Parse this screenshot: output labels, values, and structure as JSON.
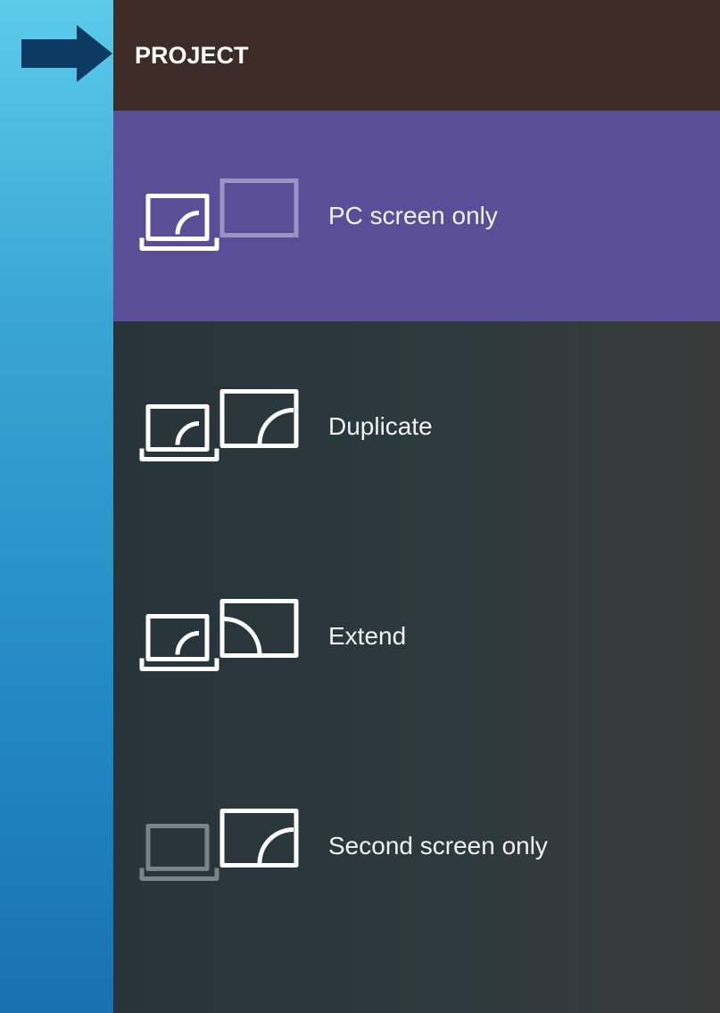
{
  "window": {
    "title": "PROJECT"
  },
  "options": [
    {
      "id": "pc-screen-only",
      "label": "PC screen only",
      "selected": true,
      "icon": "pc-screen-only-icon"
    },
    {
      "id": "duplicate",
      "label": "Duplicate",
      "selected": false,
      "icon": "duplicate-icon"
    },
    {
      "id": "extend",
      "label": "Extend",
      "selected": false,
      "icon": "extend-icon"
    },
    {
      "id": "second-screen-only",
      "label": "Second screen only",
      "selected": false,
      "icon": "second-screen-only-icon"
    }
  ],
  "colors": {
    "header_bg": "#3d2b27",
    "selected_bg": "#5a4e96",
    "panel_bg": "#2c3a3f",
    "arrow": "#0d3a62",
    "background_top": "#5ccbea",
    "background_bottom": "#1a70b0"
  }
}
